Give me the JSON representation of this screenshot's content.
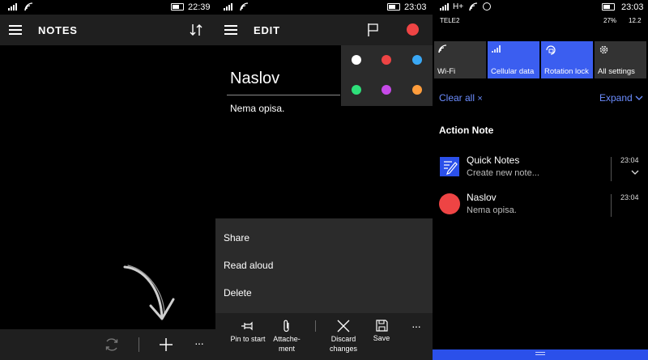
{
  "panel1": {
    "status": {
      "time": "22:39"
    },
    "title": "NOTES",
    "icons": {
      "menu": "hamburger-icon",
      "sort": "sort-icon",
      "sync": "sync-icon",
      "add": "plus-icon",
      "more": "ellipsis-icon",
      "hint": "curved-arrow-icon"
    },
    "more_label": "···"
  },
  "panel2": {
    "status": {
      "time": "23:03"
    },
    "title": "EDIT",
    "note_title": "Naslov",
    "note_body": "Nema opisa.",
    "selected_color": "#ee4444",
    "colors": [
      "#ffffff",
      "#ee4444",
      "#3aa8f5",
      "#2ee07a",
      "#c64ae8",
      "#ff9d3c"
    ],
    "context_menu": [
      "Share",
      "Read aloud",
      "Delete"
    ],
    "commands": [
      {
        "label": "Pin to start",
        "icon": "pin-icon"
      },
      {
        "label": "Attache-\nment",
        "icon": "paperclip-icon"
      },
      {
        "label": "Discard\nchanges",
        "icon": "close-icon"
      },
      {
        "label": "Save",
        "icon": "save-icon"
      }
    ],
    "more_label": "···"
  },
  "panel3": {
    "status": {
      "network": "H+",
      "carrier": "TELE2",
      "time": "23:03",
      "battery": "27%",
      "date": "12.2"
    },
    "tiles": [
      {
        "label": "Wi-Fi",
        "active": false,
        "icon": "wifi-icon"
      },
      {
        "label": "Cellular data",
        "active": true,
        "icon": "cellular-icon"
      },
      {
        "label": "Rotation lock",
        "active": true,
        "icon": "rotation-lock-icon"
      },
      {
        "label": "All settings",
        "active": false,
        "icon": "gear-icon"
      }
    ],
    "clear_all": "Clear all",
    "expand": "Expand",
    "group_title": "Action Note",
    "notifications": [
      {
        "title": "Quick Notes",
        "subtitle": "Create new note...",
        "time": "23:04",
        "icon": "quick-notes-icon"
      },
      {
        "title": "Naslov",
        "subtitle": "Nema opisa.",
        "time": "23:04",
        "icon": "red-dot-icon"
      }
    ],
    "colors": {
      "accent": "#2b50ea",
      "tile_active": "#3b5ef0",
      "tile_inactive": "#333333",
      "link": "#6c8dff"
    }
  }
}
